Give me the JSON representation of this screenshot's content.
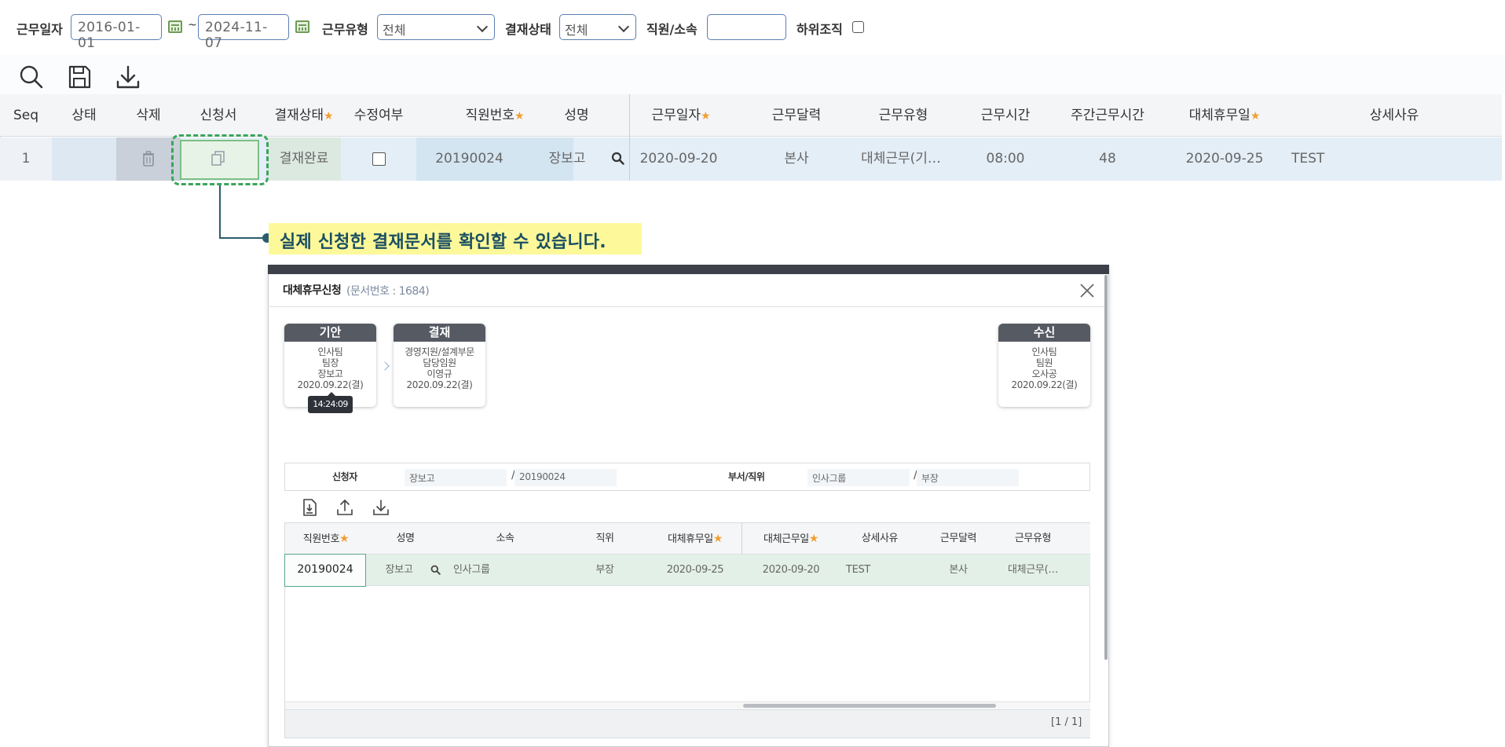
{
  "filters": {
    "work_date_label": "근무일자",
    "date_from": "2016-01-01",
    "tilde": "~",
    "date_to": "2024-11-07",
    "work_type_label": "근무유형",
    "work_type_value": "전체",
    "approval_status_label": "결재상태",
    "approval_status_value": "전체",
    "employee_label": "직원/소속",
    "employee_value": "",
    "sub_org_label": "하위조직",
    "sub_org_checked": false
  },
  "toolbar": {
    "icons": [
      "search-icon",
      "save-icon",
      "download-icon"
    ]
  },
  "grid": {
    "headers": {
      "seq": "Seq",
      "status": "상태",
      "delete": "삭제",
      "application": "신청서",
      "approval_status": "결재상태",
      "modified": "수정여부",
      "emp_no": "직원번호",
      "name": "성명",
      "work_date": "근무일자",
      "calendar": "근무달력",
      "work_type": "근무유형",
      "work_time": "근무시간",
      "weekly_hours": "주간근무시간",
      "alt_holiday": "대체휴무일",
      "reason": "상세사유"
    },
    "required_mark": "★",
    "row": {
      "seq": "1",
      "status": "",
      "approval_status": "결재완료",
      "emp_no": "20190024",
      "name": "장보고",
      "work_date": "2020-09-20",
      "calendar": "본사",
      "work_type": "대체근무(기…",
      "work_time": "08:00",
      "weekly_hours": "48",
      "alt_holiday": "2020-09-25",
      "reason": "TEST"
    }
  },
  "callout": {
    "text": "실제 신청한 결재문서를 확인할 수 있습니다."
  },
  "modal": {
    "title": "대체휴무신청",
    "doc_no": "(문서번호 : 1684)",
    "cards": [
      {
        "header": "기안",
        "lines": [
          "인사팀",
          "팀장",
          "장보고",
          "2020.09.22(결)"
        ]
      },
      {
        "header": "결재",
        "lines": [
          "경영지원/설계부문",
          "담당임원",
          "이영규",
          "2020.09.22(결)"
        ]
      },
      {
        "header": "수신",
        "lines": [
          "인사팀",
          "팀원",
          "오사공",
          "2020.09.22(결)"
        ]
      }
    ],
    "tooltip": "14:24:09",
    "info": {
      "applicant_label": "신청자",
      "applicant_name": "장보고",
      "applicant_no": "20190024",
      "dept_label": "부서/직위",
      "dept": "인사그룹",
      "position": "부장",
      "slash": "/"
    },
    "subgrid": {
      "headers": {
        "emp_no": "직원번호",
        "name": "성명",
        "org": "소속",
        "position": "직위",
        "alt_holiday": "대체휴무일",
        "alt_work": "대체근무일",
        "reason": "상세사유",
        "calendar": "근무달력",
        "work_type": "근무유형"
      },
      "row": {
        "emp_no": "20190024",
        "name": "장보고",
        "org": "인사그룹",
        "position": "부장",
        "alt_holiday": "2020-09-25",
        "alt_work": "2020-09-20",
        "reason": "TEST",
        "calendar": "본사",
        "work_type": "대체근무(…"
      }
    },
    "paging": "[1 / 1]"
  },
  "colors": {
    "accent_border": "#5b7fb5",
    "highlight_green": "#3aa55a",
    "callout_bg": "#fdf99a",
    "callout_text": "#1a4f63",
    "required_star": "#f0a030"
  }
}
